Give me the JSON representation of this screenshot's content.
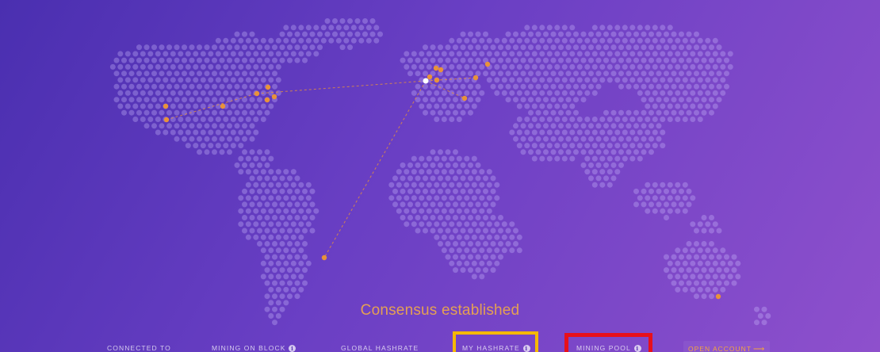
{
  "status": {
    "text": "Consensus established",
    "color": "#e5a053"
  },
  "stats": {
    "connected_to": "CONNECTED TO",
    "mining_on_block": "MINING ON BLOCK",
    "global_hashrate": "GLOBAL HASHRATE",
    "my_hashrate": "MY HASHRATE",
    "mining_pool": "MINING POOL"
  },
  "open_account": {
    "label": "OPEN ACCOUNT",
    "icon": "arrow-right-icon"
  },
  "highlights": {
    "my_hashrate_color": "#f5b800",
    "mining_pool_color": "#e8101a"
  },
  "map": {
    "dot_color": "rgba(205,190,255,0.32)",
    "node_color": "#e8923a",
    "self_node_color": "#ffffff"
  }
}
